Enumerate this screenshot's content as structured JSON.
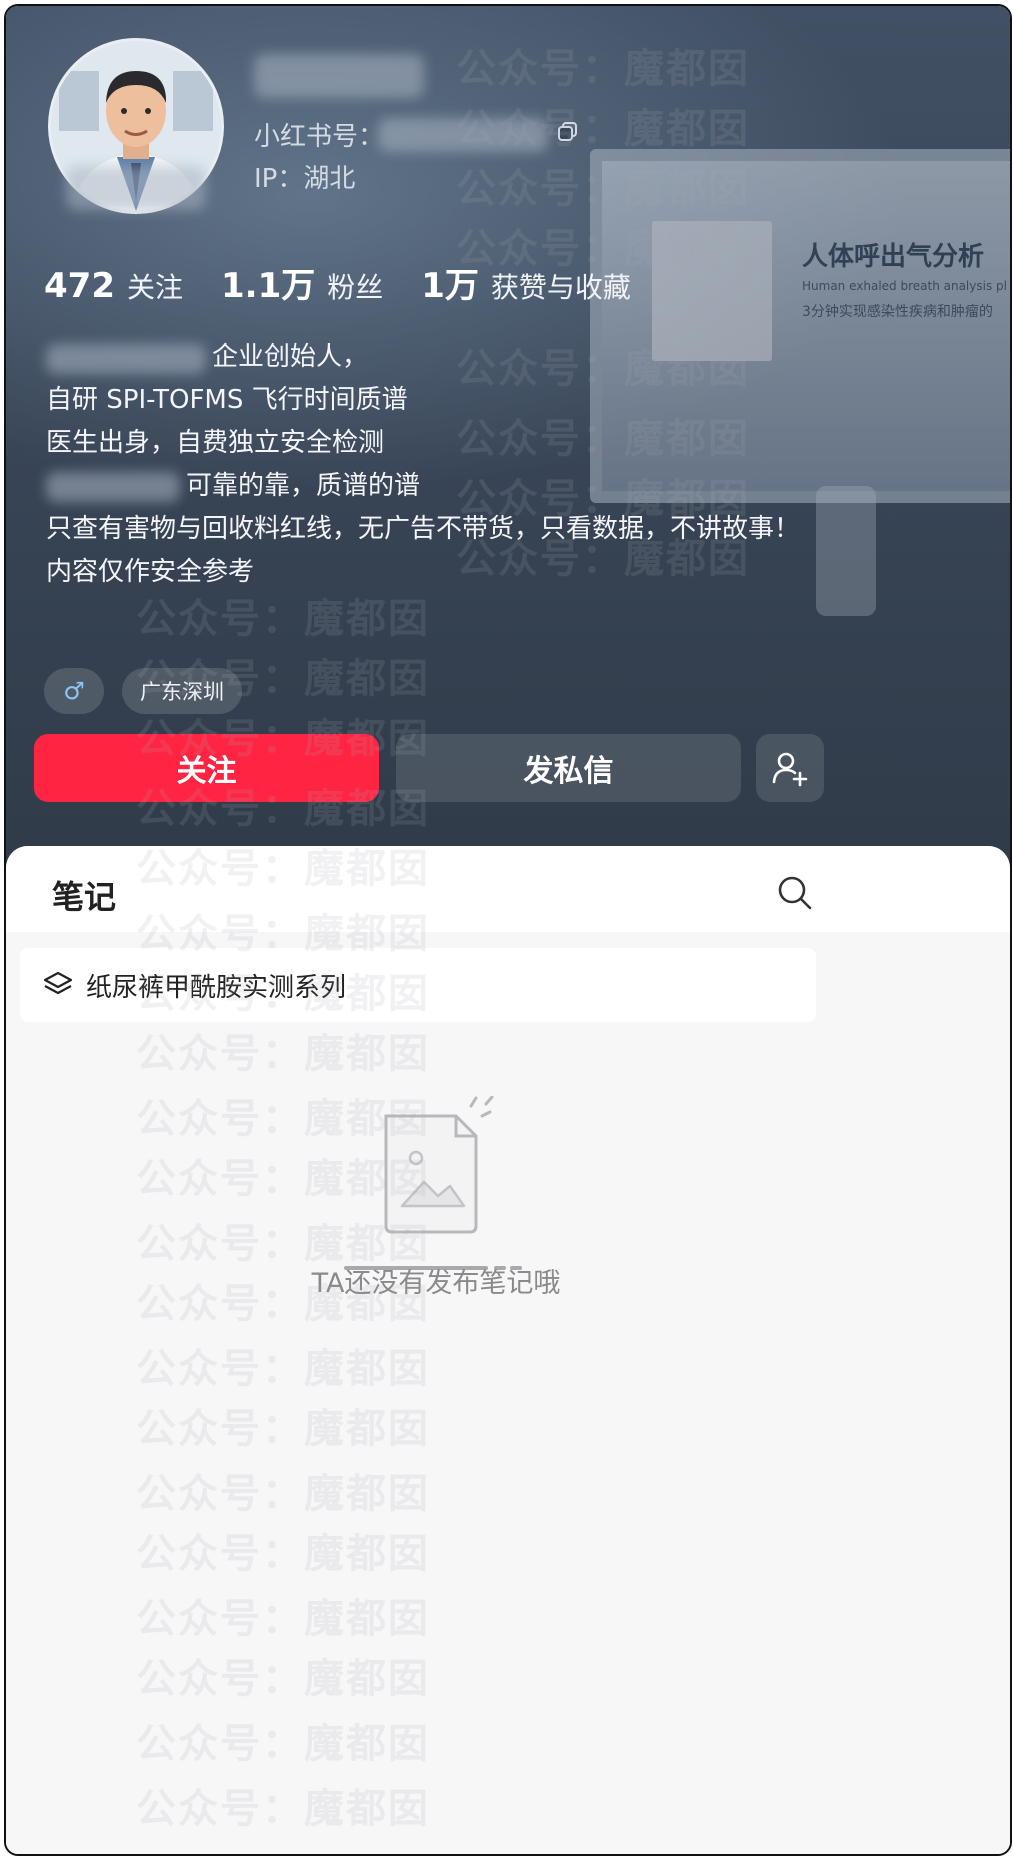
{
  "profile": {
    "id_label": "小红书号：",
    "ip_label": "IP：湖北"
  },
  "stats": [
    {
      "num": "472",
      "label": "关注"
    },
    {
      "num": "1.1万",
      "label": "粉丝"
    },
    {
      "num": "1万",
      "label": "获赞与收藏"
    }
  ],
  "bio": {
    "line1": "企业创始人，",
    "line2": "自研 SPI-TOFMS 飞行时间质谱",
    "line3": "医生出身，自费独立安全检测",
    "line4": "可靠的靠，质谱的谱",
    "line5": "只查有害物与回收料红线，无广告不带货，只看数据，不讲故事！",
    "line6": "内容仅作安全参考"
  },
  "tags": {
    "gender": "♂",
    "location": "广东深圳"
  },
  "actions": {
    "follow": "关注",
    "message": "发私信"
  },
  "notes": {
    "tab_title": "笔记",
    "collection": "纸尿裤甲酰胺实测系列",
    "empty": "TA还没有发布笔记哦"
  },
  "background": {
    "title": "人体呼出气分析",
    "subtitle": "Human exhaled breath analysis pl",
    "subtitle2": "3分钟实现感染性疾病和肿瘤的"
  },
  "watermark": "公众号：魔都囡",
  "colors": {
    "accent": "#ff2442",
    "header_bg": "#3a4759"
  }
}
